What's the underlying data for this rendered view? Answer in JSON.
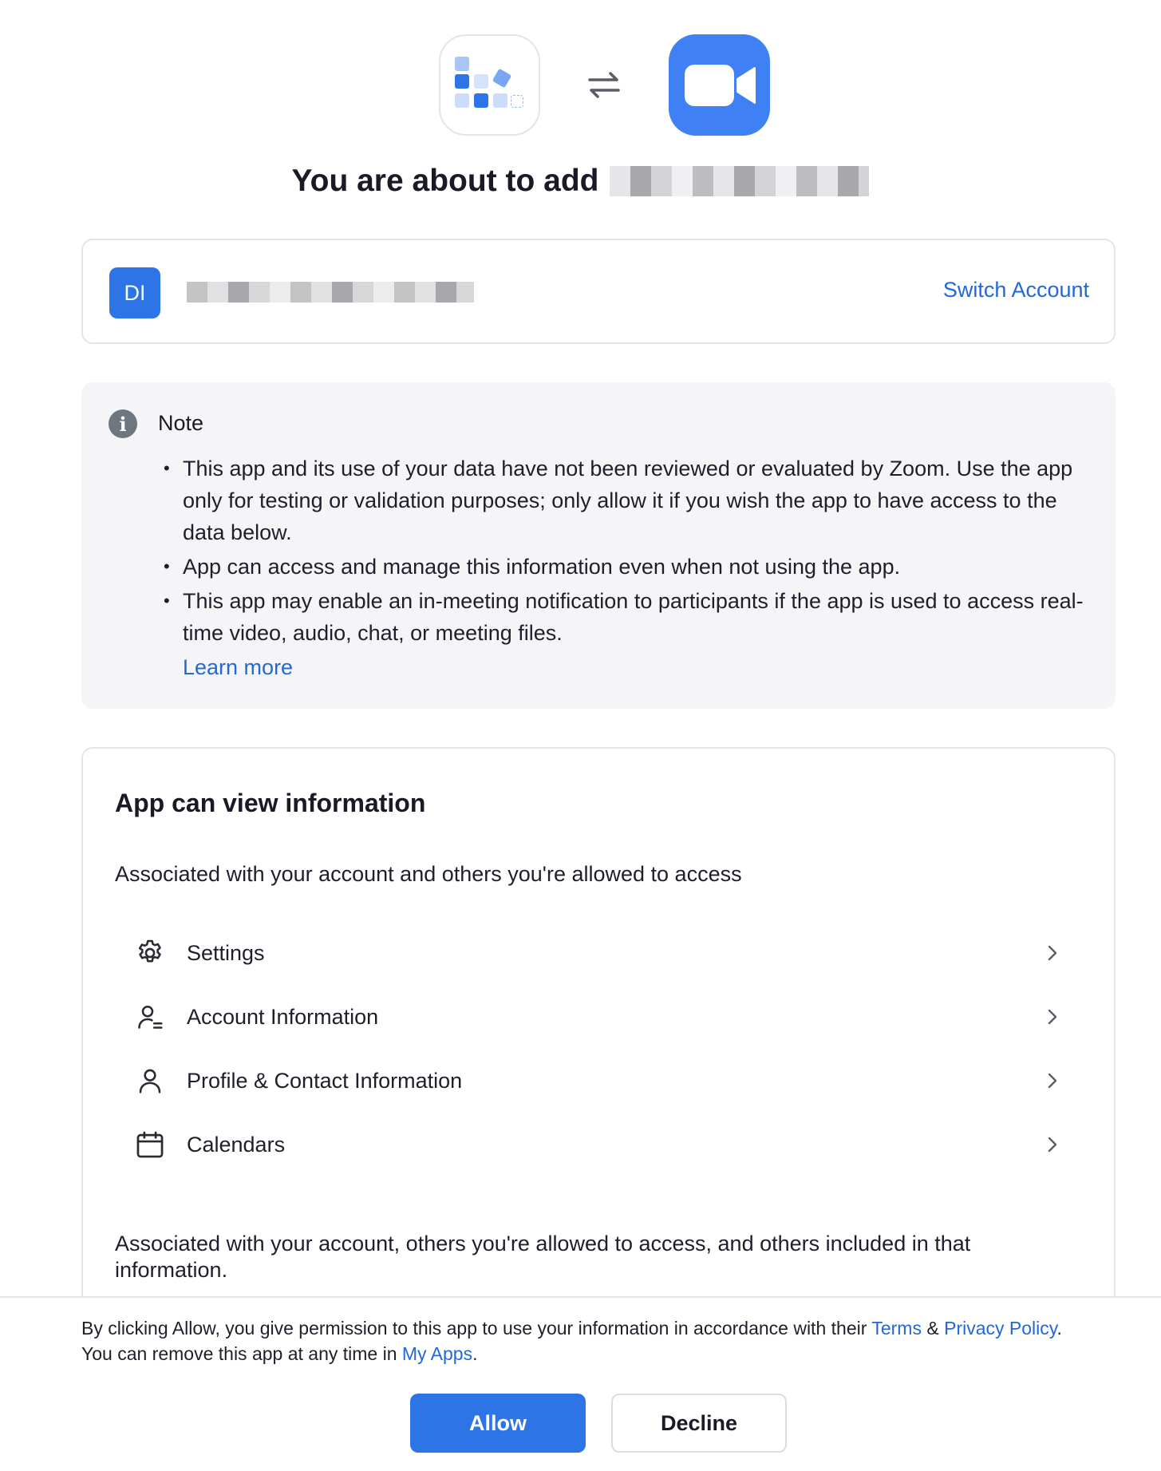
{
  "header": {
    "title_prefix": "You are about to add",
    "app_logo_icon": "app-grid-icon",
    "swap_icon": "swap-arrows-icon",
    "zoom_logo_icon": "video-camera-icon"
  },
  "account": {
    "avatar_initials": "DI",
    "switch_label": "Switch Account"
  },
  "note": {
    "title": "Note",
    "items": [
      "This app and its use of your data have not been reviewed or evaluated by Zoom. Use the app only for testing or validation purposes; only allow it if you wish the app to have access to the data below.",
      "App can access and manage this information even when not using the app.",
      "This app may enable an in-meeting notification to participants if the app is used to access real-time video, audio, chat, or meeting files."
    ],
    "learn_more": "Learn more"
  },
  "permissions": {
    "title": "App can view information",
    "subtitle": "Associated with your account and others you're allowed to access",
    "items": [
      {
        "label": "Settings",
        "icon": "gear-icon"
      },
      {
        "label": "Account Information",
        "icon": "account-info-icon"
      },
      {
        "label": "Profile & Contact Information",
        "icon": "user-icon"
      },
      {
        "label": "Calendars",
        "icon": "calendar-icon"
      }
    ],
    "subtitle2": "Associated with your account, others you're allowed to access, and others included in that information."
  },
  "footer": {
    "consent_before_terms": "By clicking Allow, you give permission to this app to use your information in accordance with their ",
    "terms": "Terms",
    "amp": " & ",
    "privacy": "Privacy Policy",
    "period": ".",
    "remove_text": "You can remove this app at any time in ",
    "my_apps": "My Apps",
    "period2": ".",
    "allow": "Allow",
    "decline": "Decline"
  },
  "colors": {
    "primary": "#2d74e7",
    "link": "#2268d8",
    "zoom_blue": "#3f81f4"
  }
}
